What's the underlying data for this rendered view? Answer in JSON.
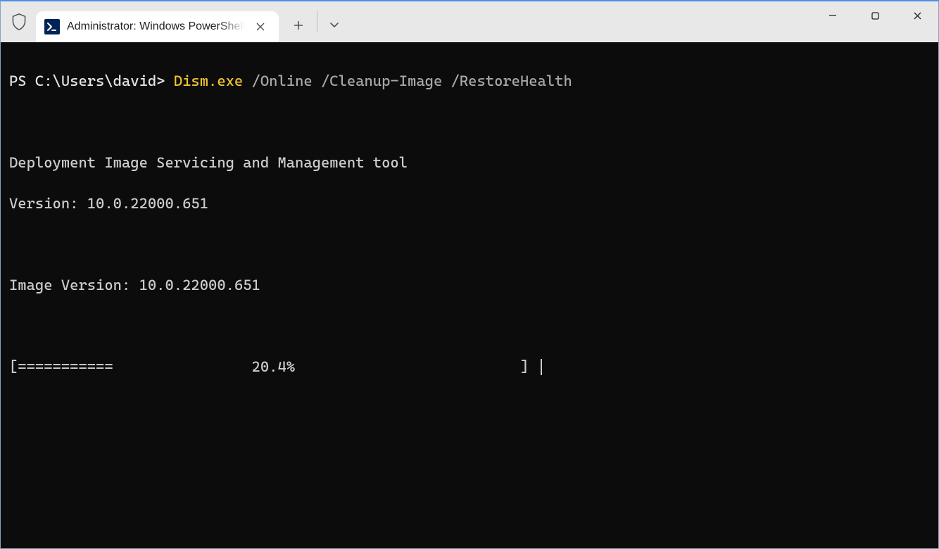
{
  "titlebar": {
    "tab_title": "Administrator: Windows PowerShell"
  },
  "terminal": {
    "prompt": "PS C:\\Users\\david> ",
    "command_exe": "Dism.exe",
    "command_args": " /Online /Cleanup-Image /RestoreHealth",
    "output_tool": "Deployment Image Servicing and Management tool",
    "output_version": "Version: 10.0.22000.651",
    "output_image_version": "Image Version: 10.0.22000.651",
    "progress_bar": "[===========                20.4%                          ] "
  }
}
